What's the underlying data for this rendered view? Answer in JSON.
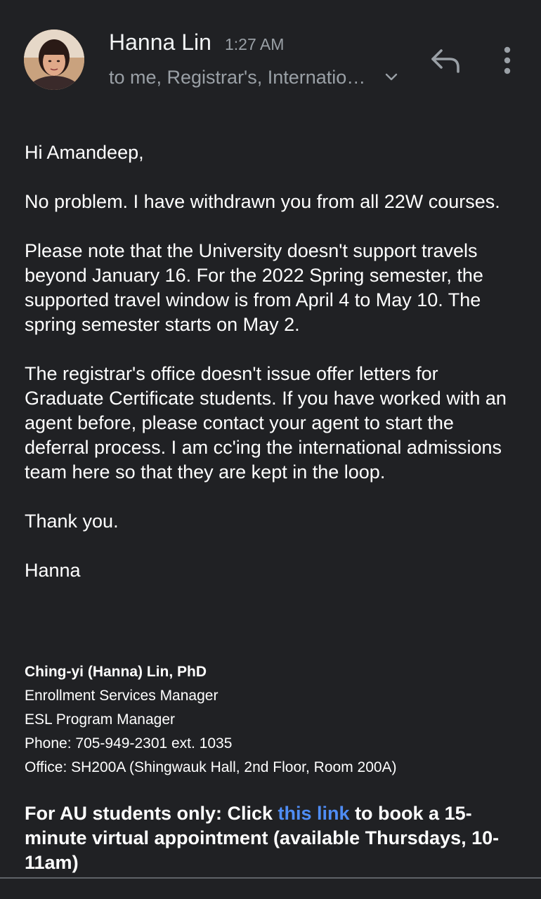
{
  "email": {
    "sender_name": "Hanna Lin",
    "time": "1:27 AM",
    "recipients": "to me, Registrar's, International Admissions"
  },
  "icons": {
    "avatar": "sender-avatar",
    "chevron": "chevron-down-icon",
    "reply": "reply-icon",
    "more": "more-vert-icon"
  },
  "body": {
    "greeting": "Hi Amandeep,",
    "p1": "No problem. I have withdrawn you from all 22W courses.",
    "p2": "Please note that the University doesn't support travels beyond January 16. For the 2022 Spring semester, the supported travel window is from April 4 to May 10. The spring semester starts on May 2.",
    "p3": "The registrar's office doesn't issue offer letters for Graduate Certificate students. If you have worked with an agent before, please contact your agent to start the deferral process. I am cc'ing the international admissions team here so that they are kept in the loop.",
    "thanks": "Thank you.",
    "sign_off": "Hanna"
  },
  "signature": {
    "name": "Ching-yi (Hanna) Lin, PhD",
    "title1": "Enrollment Services Manager",
    "title2": "ESL Program Manager",
    "phone": "Phone: 705-949-2301 ext. 1035",
    "office": "Office: SH200A (Shingwauk Hall, 2nd Floor, Room 200A)"
  },
  "cta": {
    "prefix": "For AU students only: Click ",
    "link_text": "this link",
    "suffix": " to book a 15-minute virtual appointment (available Thursdays, 10-11am)"
  },
  "colors": {
    "background": "#202124",
    "text": "#ffffff",
    "secondary_text": "#9aa0a6",
    "link": "#4f8df5"
  }
}
